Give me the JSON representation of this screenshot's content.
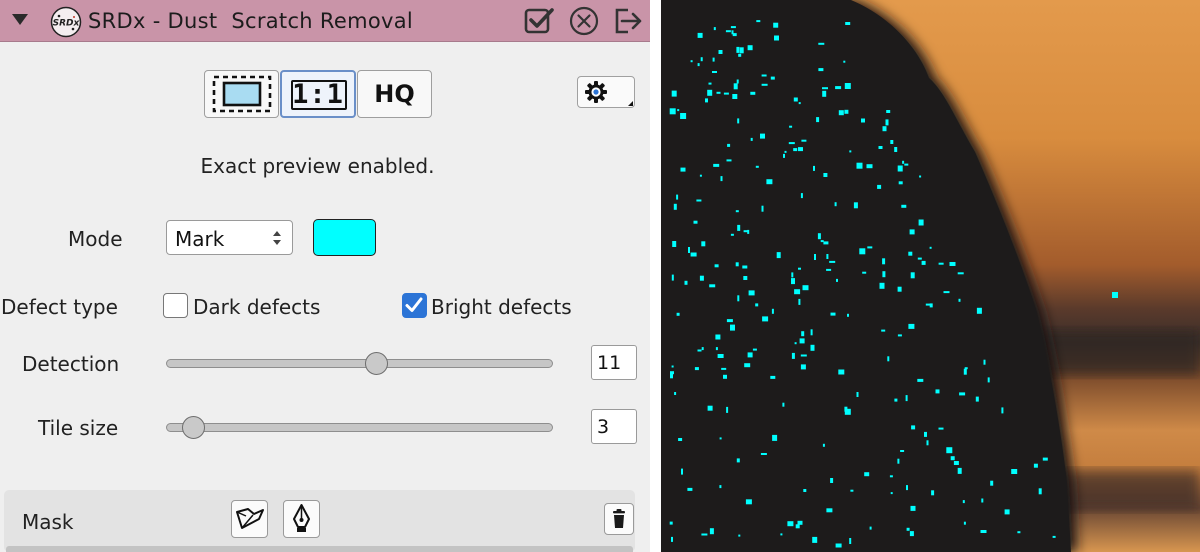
{
  "plugin": {
    "title": "SRDx - Dust  Scratch Removal",
    "logo_text": "SRDx"
  },
  "view_buttons": {
    "one_to_one_label": "1:1",
    "hq_label": "HQ"
  },
  "status_text": "Exact preview enabled.",
  "mode": {
    "label": "Mode",
    "value": "Mark",
    "mark_color": "#00ffff"
  },
  "defect_type": {
    "label": "Defect type",
    "dark_label": "Dark defects",
    "dark_checked": false,
    "bright_label": "Bright defects",
    "bright_checked": true
  },
  "detection": {
    "label": "Detection",
    "value": "11"
  },
  "tile_size": {
    "label": "Tile size",
    "value": "3"
  },
  "mask": {
    "label": "Mask"
  },
  "colors": {
    "title_bar": "#c994a8",
    "accent": "#2c74d6",
    "mark": "#00ffff"
  },
  "icons": [
    "collapse-arrow-icon",
    "srdx-logo-icon",
    "apply-checkmark-icon",
    "close-circle-icon",
    "exit-icon",
    "fit-view-icon",
    "settings-gear-icon",
    "select-arrows-icon",
    "mask-brush-icon",
    "mask-pen-icon",
    "trash-icon"
  ]
}
